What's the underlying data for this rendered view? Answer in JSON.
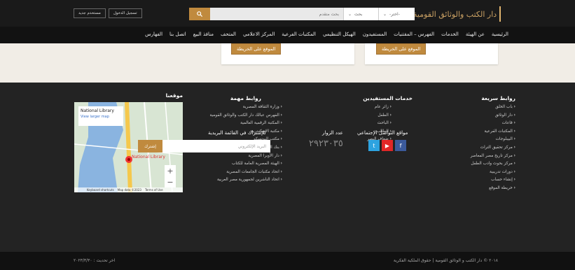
{
  "header": {
    "logo_text": "دار الكتب والوثائق القومية",
    "auth": {
      "new_user": "مستخدم جديد",
      "login": "تسجيل الدخول"
    },
    "search": {
      "placeholder": "بحث متقدم",
      "type_label": "بحث",
      "choose_label": "-اختر-"
    }
  },
  "nav": {
    "items": [
      "الرئيسية",
      "عن الهيئة",
      "الخدمات",
      "الفهرس – المقتنيات",
      "المستفيدون",
      "الهيكل التنظيمي",
      "المكتبات الفرعية",
      "المركز الاعلامي",
      "المتحف",
      "منافذ البيع",
      "اتصل بنا",
      "الفهارس"
    ]
  },
  "cards": {
    "map_button": "الموقع على الخريطة"
  },
  "footer": {
    "quick_links": {
      "title": "روابط سريعة",
      "items": [
        "باب الخلق",
        "دار الوثائق",
        "قاعات",
        "المكتبات الفرعية",
        "البيبلوجات",
        "مركز تحقيق التراث",
        "مركز تاريخ مصر المعاصر",
        "مركز بحوث وادب الطفل",
        "دورات تدريبية",
        "إنشاء حساب",
        "خريطة الموقع"
      ]
    },
    "beneficiaries": {
      "title": "خدمات المستفيدين",
      "items": [
        "زائر عام",
        "الطفل",
        "الباحث",
        "الطالب",
        "ضعاف البصر"
      ]
    },
    "important_links": {
      "title": "روابط مهمة",
      "items": [
        "وزارة الثقافة المصرية",
        "الفهرس عبالك دار الكتب والوثائق القومية",
        "المكتبة الرقمية العالمية",
        "مكتبة الاسكندرية",
        "مكتب اليونسكو",
        "بنك المعرفة المصرية",
        "دار الأوبرا المصرية",
        "الهيئة المصرية العامة للكتاب",
        "اتحاد مكتبات الجامعات المصرية",
        "اتحاد الناشرين لجمهورية مصر العربية"
      ]
    },
    "location": {
      "title": "موقعنا",
      "map_place": "National Library",
      "map_link": "View larger map",
      "pin_label": "National Library",
      "map_footer": [
        "Keyboard shortcuts",
        "Map data ©2023",
        "Terms of Use"
      ]
    },
    "social": {
      "title": "مواقع التواصل الإجتماعي"
    },
    "visitors": {
      "title": "عدد الزوار",
      "count": "٢٩٢٣٠٣٥"
    },
    "newsletter": {
      "title": "للإشتراك في القائمة البريدية",
      "placeholder": "البريد الإلكتروني",
      "button": "إشترك"
    },
    "copyright": "٢٠١٨ © دار الكتب و الوثائق القومية | حقوق الملكية الفكرية",
    "updated": "اخر تحديث : ٢٠٢٣/٣/٣٠"
  },
  "colors": {
    "accent": "#c08a3e",
    "twitter": "#2da3e0",
    "youtube": "#e12727",
    "facebook": "#3b5a9b"
  }
}
